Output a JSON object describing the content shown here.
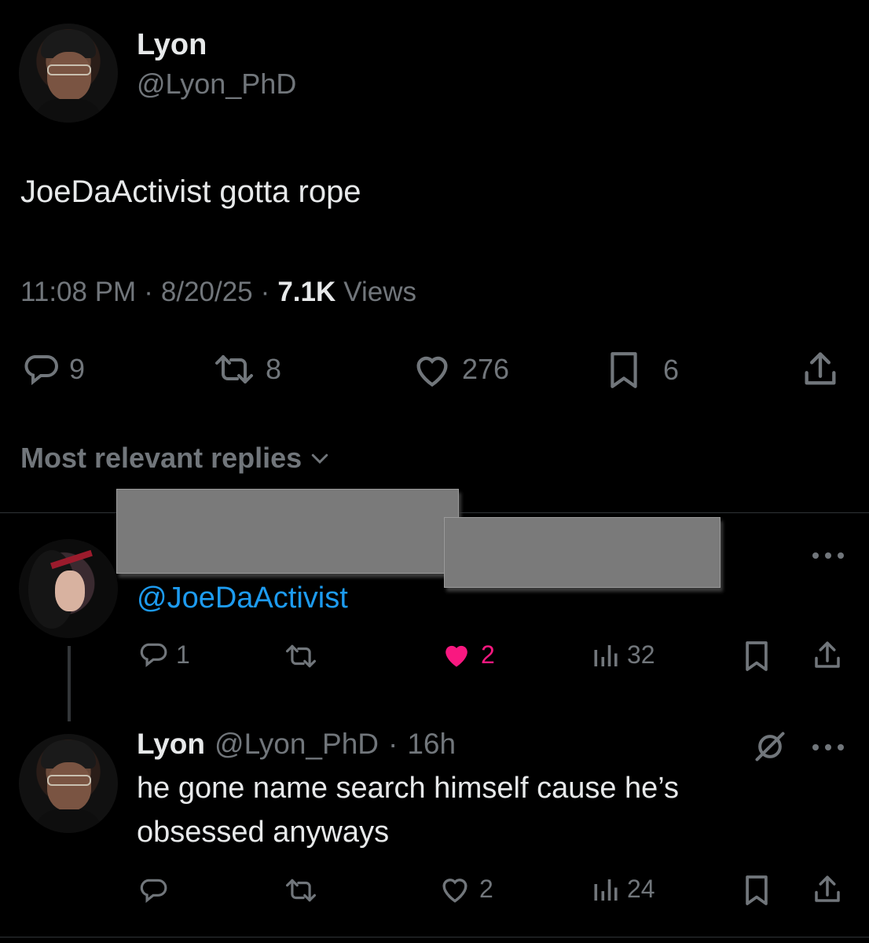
{
  "tweet": {
    "author_name": "Lyon",
    "author_handle": "@Lyon_PhD",
    "text": "JoeDaActivist gotta rope",
    "time": "11:08 PM",
    "sep1": "·",
    "date": "8/20/25",
    "sep2": "·",
    "views_count": "7.1K",
    "views_label": "Views",
    "replies": "9",
    "reposts": "8",
    "likes": "276",
    "bookmarks": "6"
  },
  "replies_header": {
    "label": "Most relevant replies"
  },
  "reply1": {
    "mention": "@JoeDaActivist",
    "replies": "1",
    "likes": "2",
    "views": "32",
    "like_color": "#f91880"
  },
  "reply2": {
    "author_name": "Lyon",
    "author_handle": "@Lyon_PhD",
    "sep": "·",
    "age": "16h",
    "text_line1": "he gone name search himself cause he’s",
    "text_line2": "obsessed anyways",
    "likes": "2",
    "views": "24"
  },
  "colors": {
    "background": "#000000",
    "text": "#e7e9ea",
    "muted": "#71767b",
    "link": "#1d9bf0",
    "like": "#f91880"
  }
}
